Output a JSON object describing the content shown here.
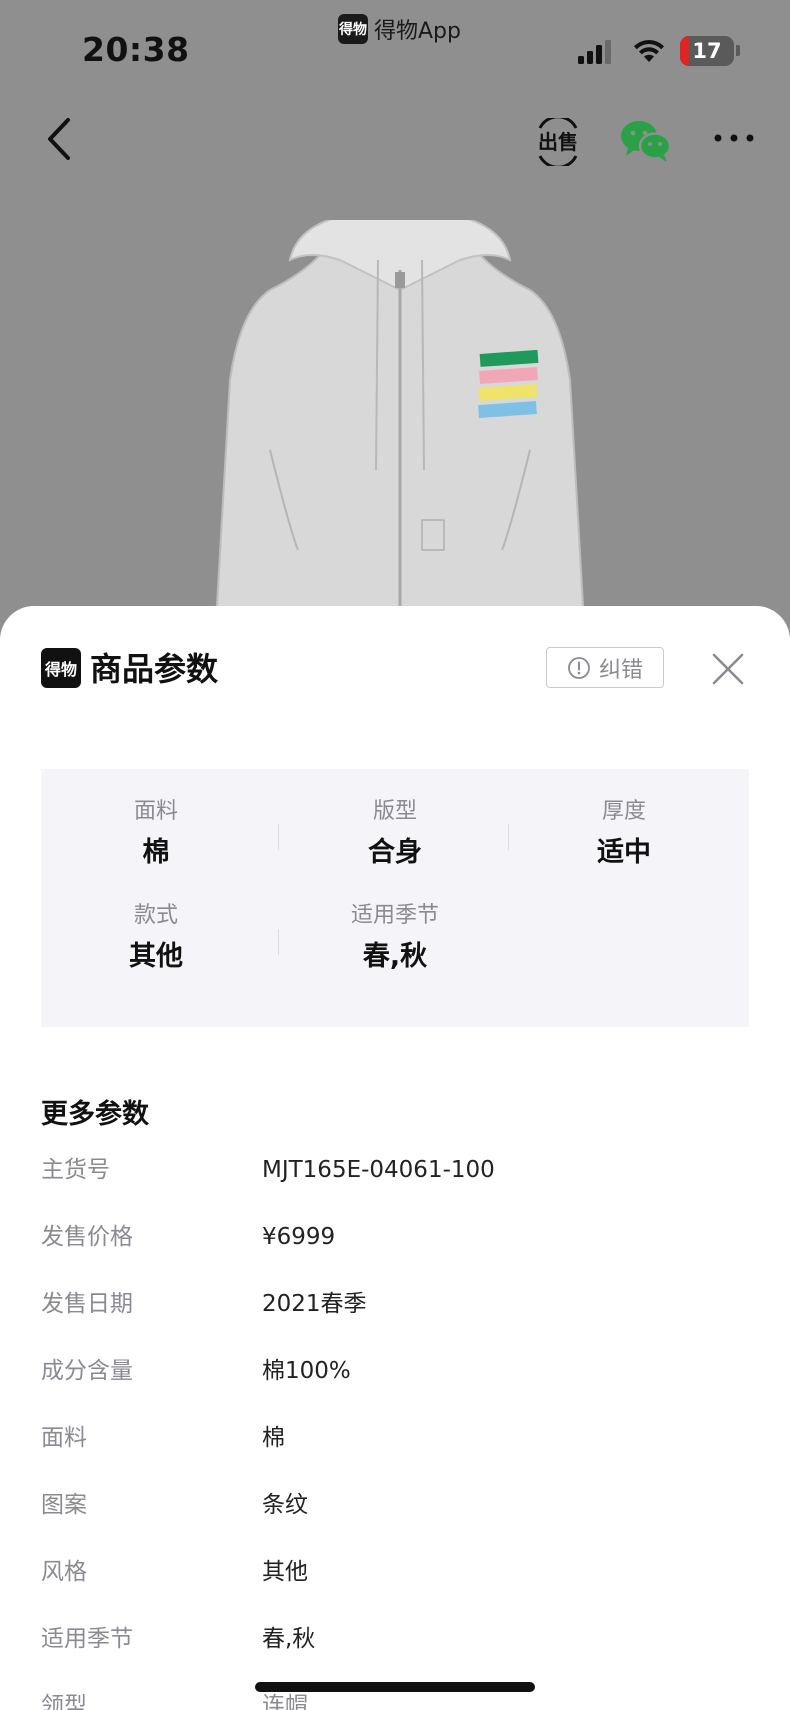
{
  "status_bar": {
    "time": "20:38",
    "app_name": "得物App",
    "app_logo_text": "得物",
    "battery_level": "17",
    "battery_fraction": 0.17,
    "icons": [
      "signal-icon",
      "wifi-icon",
      "battery-icon"
    ]
  },
  "nav": {
    "icons": [
      "back-icon",
      "sell-icon",
      "wechat-icon",
      "more-icon"
    ],
    "sell_icon_text": "出售"
  },
  "product": {
    "stripe_colors": [
      "#1f9a5a",
      "#f2a7b8",
      "#f0e36a",
      "#7fc1e6"
    ]
  },
  "sheet": {
    "logo_text": "得物",
    "title": "商品参数",
    "report_label": "纠错",
    "summary": [
      {
        "label": "面料",
        "value": "棉"
      },
      {
        "label": "版型",
        "value": "合身"
      },
      {
        "label": "厚度",
        "value": "适中"
      },
      {
        "label": "款式",
        "value": "其他"
      },
      {
        "label": "适用季节",
        "value": "春,秋"
      }
    ],
    "more_title": "更多参数",
    "params": [
      {
        "label": "主货号",
        "value": "MJT165E-04061-100"
      },
      {
        "label": "发售价格",
        "value": "¥6999"
      },
      {
        "label": "发售日期",
        "value": "2021春季"
      },
      {
        "label": "成分含量",
        "value": "棉100%"
      },
      {
        "label": "面料",
        "value": "棉"
      },
      {
        "label": "图案",
        "value": "条纹"
      },
      {
        "label": "风格",
        "value": "其他"
      },
      {
        "label": "适用季节",
        "value": "春,秋"
      },
      {
        "label": "领型",
        "value": "连帽"
      }
    ]
  },
  "colors": {
    "sheet_bg": "#ffffff",
    "summary_bg": "#f5f5f9",
    "muted_text": "#8a8a92",
    "battery_red": "#e02424"
  }
}
